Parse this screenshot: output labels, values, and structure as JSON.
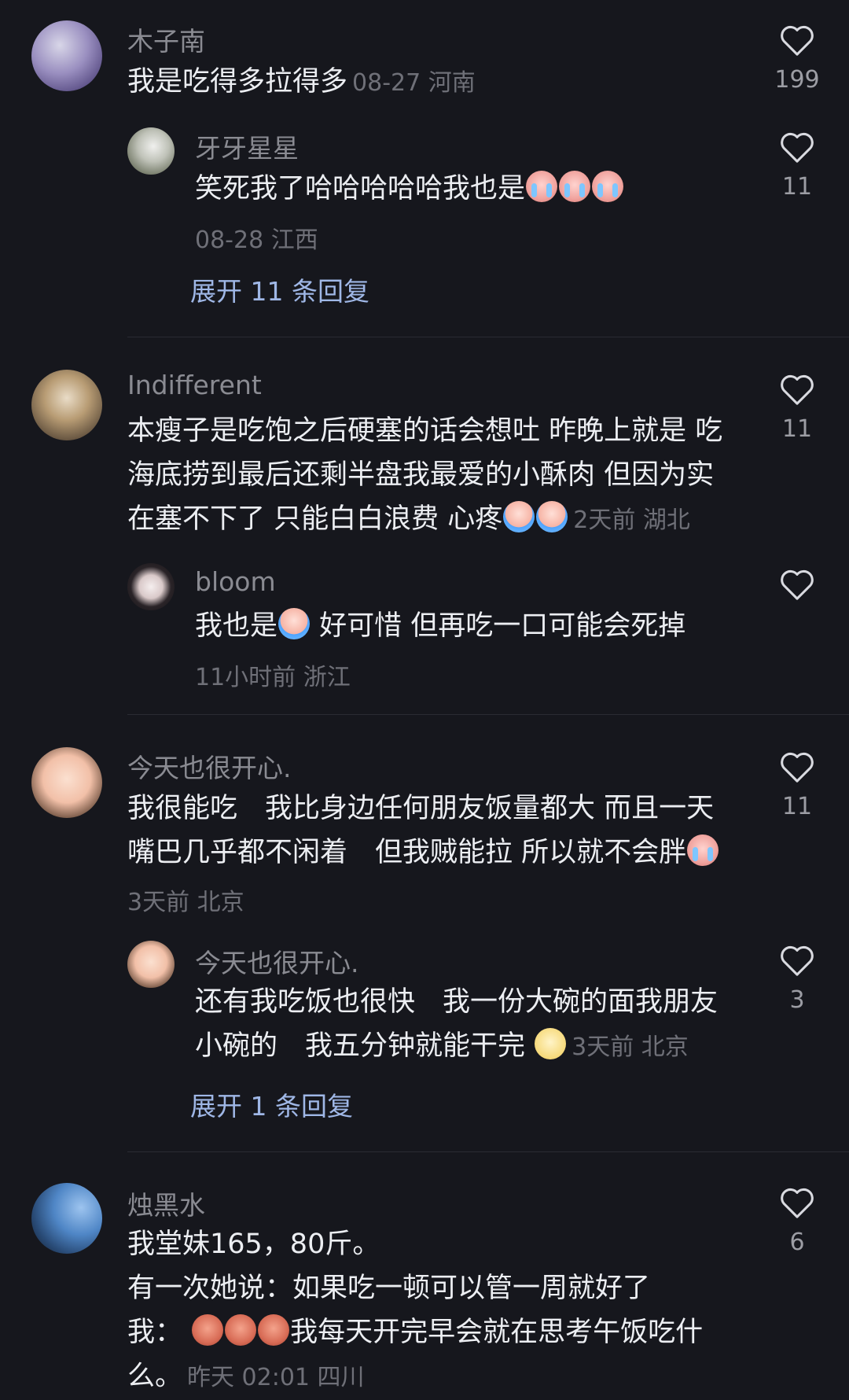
{
  "comments": [
    {
      "name": "木子南",
      "text": "我是吃得多拉得多",
      "meta": "08-27 河南",
      "likes": "199",
      "reply": {
        "name": "牙牙星星",
        "text": "笑死我了哈哈哈哈哈我也是",
        "meta": "08-28 江西",
        "likes": "11",
        "emoji_count": 3
      },
      "expand": "展开 11 条回复"
    },
    {
      "name": "Indifferent",
      "line1": "本瘦子是吃饱之后硬塞的话会想吐 昨晚上就是 吃",
      "line2": "海底捞到最后还剩半盘我最爱的小酥肉 但因为实",
      "line3": "在塞不下了 只能白白浪费 心疼",
      "meta": "2天前 湖北",
      "likes": "11",
      "reply": {
        "name": "bloom",
        "text_a": "我也是",
        "text_b": "好可惜 但再吃一口可能会死掉",
        "meta": "11小时前 浙江",
        "likes": ""
      }
    },
    {
      "name": "今天也很开心.",
      "line1": "我很能吃　我比身边任何朋友饭量都大 而且一天",
      "line2": "嘴巴几乎都不闲着　但我贼能拉 所以就不会胖",
      "meta": "3天前 北京",
      "likes": "11",
      "reply": {
        "name": "今天也很开心.",
        "line1": "还有我吃饭也很快　我一份大碗的面我朋友",
        "line2": "小碗的　我五分钟就能干完",
        "meta": "3天前 北京",
        "likes": "3"
      },
      "expand": "展开 1 条回复"
    },
    {
      "name": "烛黑水",
      "line1": "我堂妹165，80斤。",
      "line2": "有一次她说：如果吃一顿可以管一周就好了",
      "line3a": "我：",
      "line3b": "我每天开完早会就在思考午饭吃什",
      "line4": "么。",
      "meta": "昨天 02:01 四川",
      "likes": "6"
    }
  ],
  "icons": {
    "like": "heart-outline-icon",
    "avatar": "user-avatar"
  },
  "colors": {
    "background": "#16171d",
    "name": "#8a8b92",
    "expand": "#9fb7e6"
  }
}
